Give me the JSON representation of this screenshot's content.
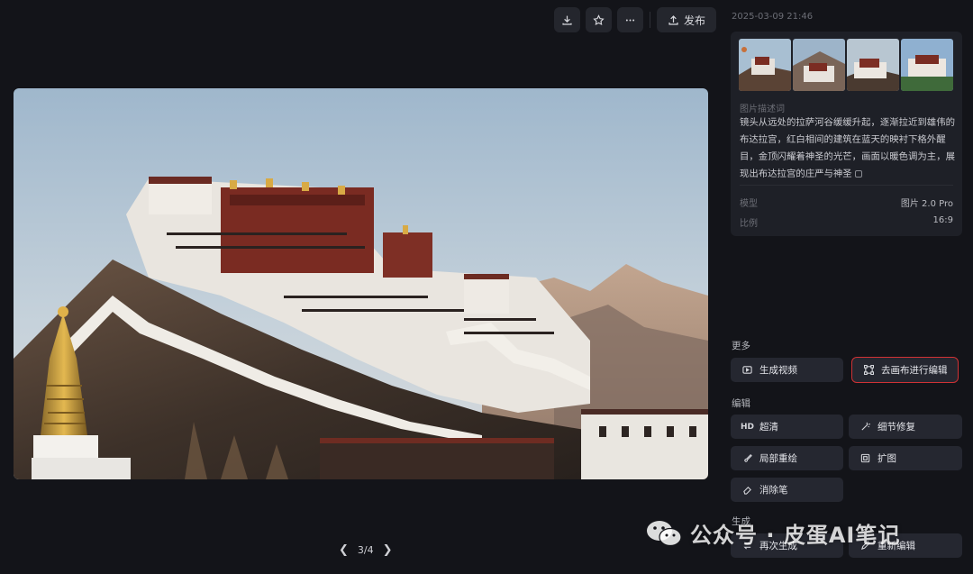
{
  "toolbar": {
    "download_icon": "download-icon",
    "favorite_icon": "star-icon",
    "more_icon": "more-icon",
    "publish_icon": "upload-icon",
    "publish_label": "发布"
  },
  "image": {
    "subject": "Potala Palace",
    "pager": "3/4"
  },
  "info": {
    "timestamp": "2025-03-09 21:46",
    "thumbnail_count": 4,
    "description_label": "图片描述词",
    "description": "镜头从远处的拉萨河谷缓缓升起，逐渐拉近到雄伟的布达拉宫，红白相间的建筑在蓝天的映衬下格外醒目，金顶闪耀着神圣的光芒，画面以暖色调为主，展现出布达拉宫的庄严与神圣",
    "model_label": "模型",
    "model_value": "图片 2.0 Pro",
    "ratio_label": "比例",
    "ratio_value": "16:9"
  },
  "more": {
    "title": "更多",
    "generate_video": "生成视频",
    "edit_on_canvas": "去画布进行编辑"
  },
  "edit": {
    "title": "编辑",
    "hd_icon_text": "HD",
    "hd": "超清",
    "detail_fix": "细节修复",
    "partial_redraw": "局部重绘",
    "expand": "扩图",
    "eraser": "消除笔"
  },
  "generate": {
    "title": "生成",
    "regenerate": "再次生成",
    "reedit": "重新编辑"
  },
  "watermark": {
    "text": "公众号 · 皮蛋AI笔记"
  },
  "colors": {
    "background": "#131419",
    "card": "#1e2027",
    "button": "#252730",
    "highlight": "#d03235"
  }
}
